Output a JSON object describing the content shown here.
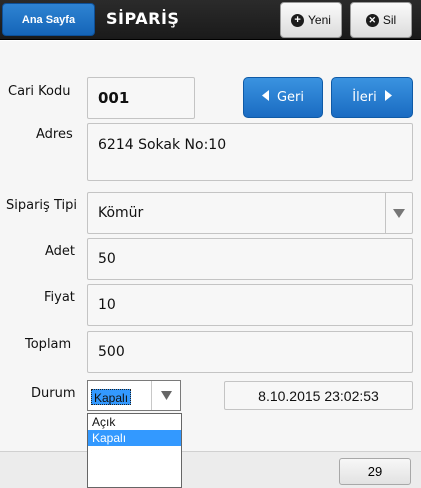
{
  "header": {
    "home_label": "Ana Sayfa",
    "title": "SİPARİŞ",
    "new_label": "Yeni",
    "delete_label": "Sil"
  },
  "form": {
    "cari_kodu": {
      "label": "Cari Kodu",
      "value": "001"
    },
    "adres": {
      "label": "Adres",
      "value": "6214 Sokak No:10"
    },
    "siparis_tipi": {
      "label": "Sipariş Tipi",
      "value": "Kömür"
    },
    "adet": {
      "label": "Adet",
      "value": "50"
    },
    "fiyat": {
      "label": "Fiyat",
      "value": "10"
    },
    "toplam": {
      "label": "Toplam",
      "value": "500"
    },
    "durum": {
      "label": "Durum",
      "value": "Kapalı",
      "options": [
        "Açık",
        "Kapalı"
      ],
      "selected_index": 1
    },
    "timestamp": "8.10.2015 23:02:53"
  },
  "nav": {
    "prev_label": "Geri",
    "next_label": "İleri"
  },
  "footer": {
    "record_count": "29"
  },
  "colors": {
    "accent": "#1a6bc2",
    "header_bg": "#1f1f1f",
    "selection": "#3399ff"
  }
}
